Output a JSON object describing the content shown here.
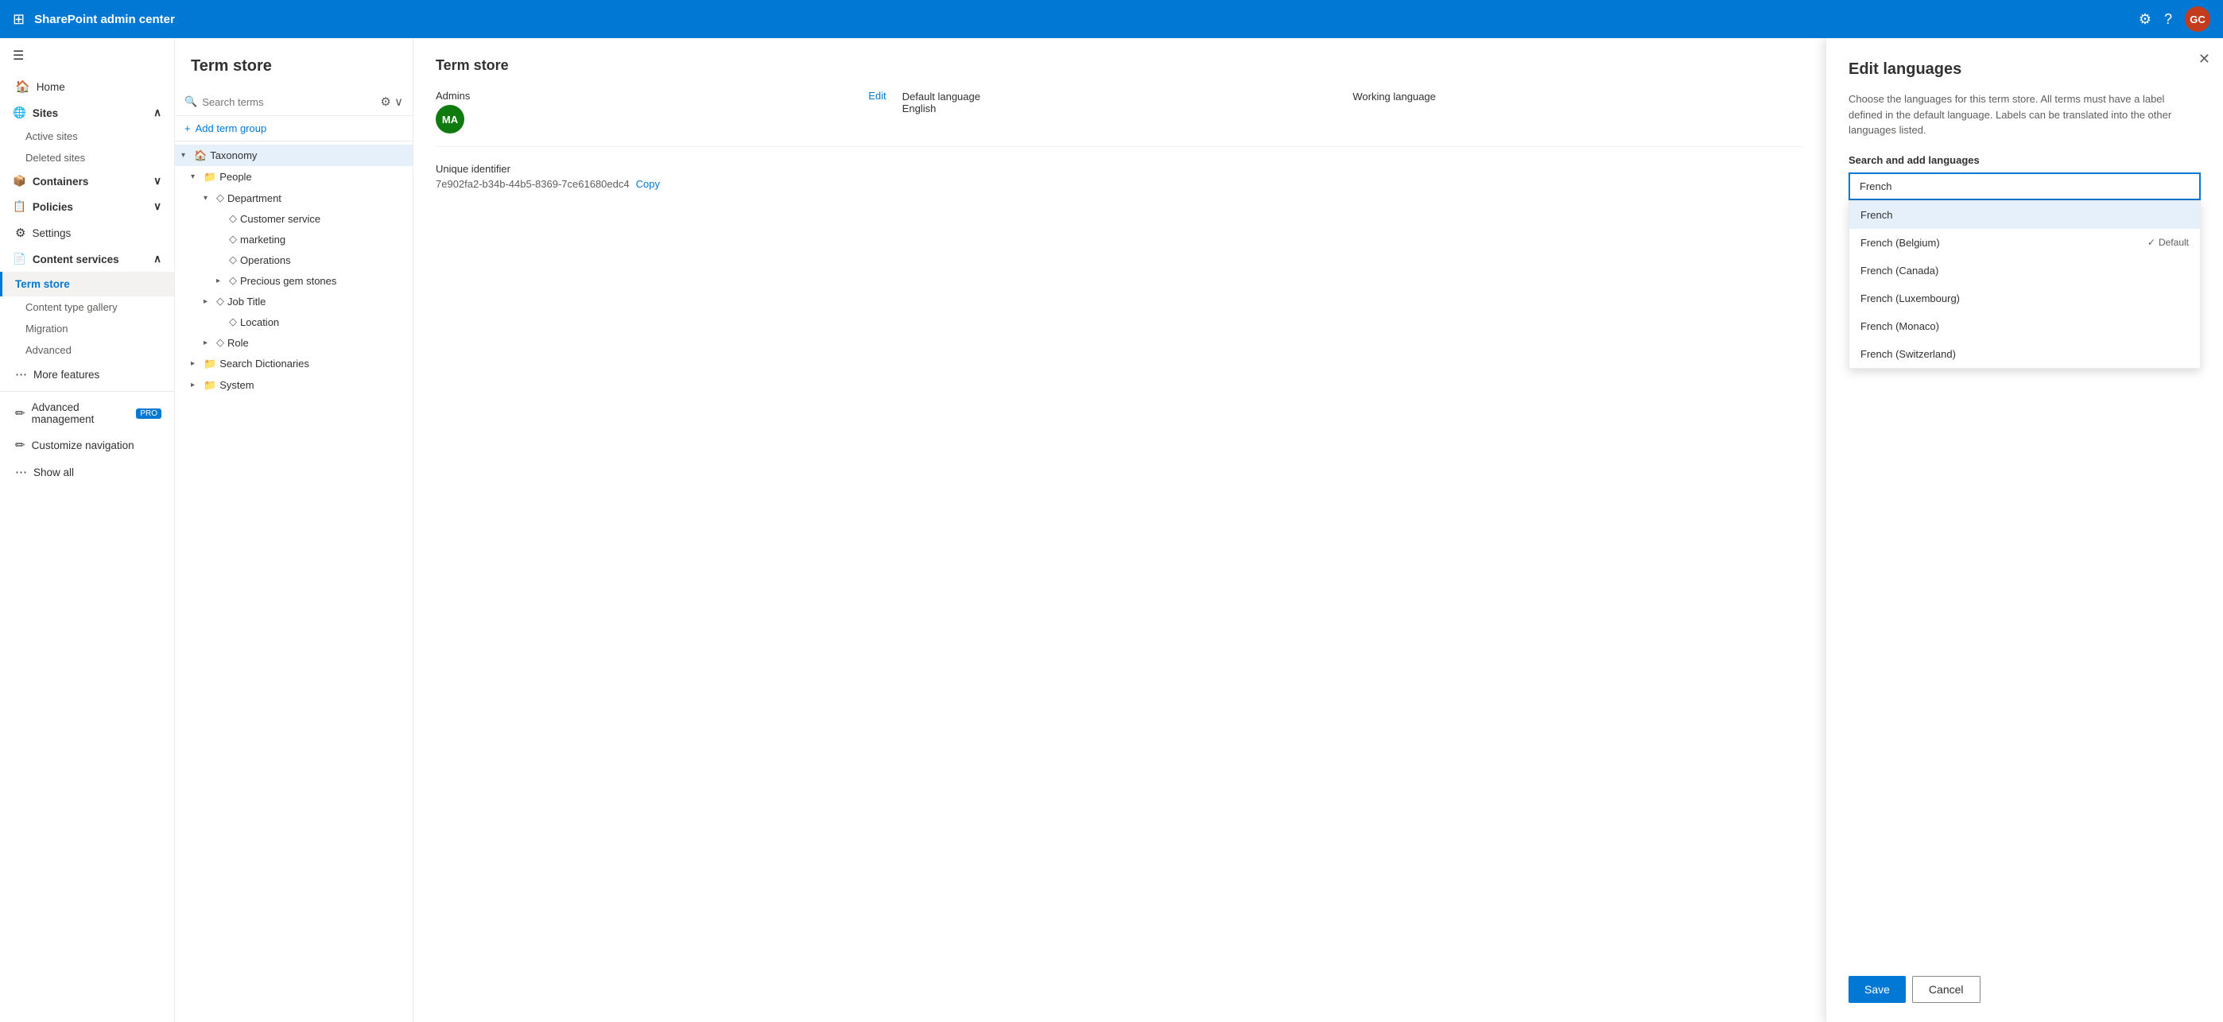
{
  "topbar": {
    "title": "SharePoint admin center",
    "waffle_icon": "⊞",
    "settings_icon": "⚙",
    "help_icon": "?",
    "avatar_initials": "GC"
  },
  "sidebar": {
    "hamburger_icon": "☰",
    "items": [
      {
        "id": "home",
        "label": "Home",
        "icon": "🏠"
      },
      {
        "id": "sites",
        "label": "Sites",
        "icon": "🌐",
        "expanded": true,
        "children": [
          {
            "id": "active-sites",
            "label": "Active sites"
          },
          {
            "id": "deleted-sites",
            "label": "Deleted sites"
          }
        ]
      },
      {
        "id": "containers",
        "label": "Containers",
        "icon": "📦",
        "expanded": false
      },
      {
        "id": "policies",
        "label": "Policies",
        "icon": "📋",
        "expanded": false
      },
      {
        "id": "settings",
        "label": "Settings",
        "icon": "⚙"
      },
      {
        "id": "content-services",
        "label": "Content services",
        "icon": "📄",
        "expanded": true,
        "children": [
          {
            "id": "term-store",
            "label": "Term store",
            "active": true
          },
          {
            "id": "content-type-gallery",
            "label": "Content type gallery"
          },
          {
            "id": "migration",
            "label": "Migration"
          },
          {
            "id": "advanced",
            "label": "Advanced"
          }
        ]
      },
      {
        "id": "more-features",
        "label": "More features",
        "icon": "⋯"
      },
      {
        "id": "advanced-management",
        "label": "Advanced management",
        "icon": "✏",
        "badge": "PRO"
      },
      {
        "id": "customize-navigation",
        "label": "Customize navigation",
        "icon": "✏"
      },
      {
        "id": "show-all",
        "label": "Show all",
        "icon": "⋯"
      }
    ]
  },
  "term_store": {
    "page_title": "Term store",
    "search_placeholder": "Search terms",
    "add_term_group_label": "Add term group",
    "tree": [
      {
        "id": "taxonomy",
        "label": "Taxonomy",
        "level": 0,
        "icon": "🏠",
        "has_children": true,
        "expanded": true,
        "has_more": true
      },
      {
        "id": "people",
        "label": "People",
        "level": 1,
        "icon": "📁",
        "has_children": true,
        "expanded": true,
        "has_more": true
      },
      {
        "id": "department",
        "label": "Department",
        "level": 2,
        "icon": "◇",
        "has_children": true,
        "expanded": true
      },
      {
        "id": "customer-service",
        "label": "Customer service",
        "level": 3,
        "icon": "◇"
      },
      {
        "id": "marketing",
        "label": "marketing",
        "level": 3,
        "icon": "◇"
      },
      {
        "id": "operations",
        "label": "Operations",
        "level": 3,
        "icon": "◇"
      },
      {
        "id": "precious-gem-stones",
        "label": "Precious gem stones",
        "level": 3,
        "icon": "◇✦",
        "has_children": true
      },
      {
        "id": "job-title",
        "label": "Job Title",
        "level": 2,
        "icon": "◇",
        "has_children": true
      },
      {
        "id": "location",
        "label": "Location",
        "level": 3,
        "icon": "◇"
      },
      {
        "id": "role",
        "label": "Role",
        "level": 2,
        "icon": "◇",
        "has_children": true
      },
      {
        "id": "search-dictionaries",
        "label": "Search Dictionaries",
        "level": 1,
        "icon": "📁",
        "has_children": true,
        "has_more": true
      },
      {
        "id": "system",
        "label": "System",
        "level": 1,
        "icon": "📁",
        "has_children": true,
        "has_more_x": true
      }
    ]
  },
  "detail_panel": {
    "title": "Term store",
    "admins_label": "Admins",
    "admins_edit": "Edit",
    "admin_avatar": "MA",
    "default_language_label": "Default language",
    "default_language_value": "English",
    "working_language_label": "Working language",
    "unique_identifier_label": "Unique identifier",
    "unique_identifier_value": "7e902fa2-b34b-44b5-8369-7ce61680edc4",
    "unique_identifier_copy": "Copy"
  },
  "edit_panel": {
    "title": "Edit languages",
    "description": "Choose the languages for this term store. All terms must have a label defined in the default language. Labels can be translated into the other languages listed.",
    "search_label": "Search and add languages",
    "search_value": "French",
    "dropdown_options": [
      {
        "id": "french",
        "label": "French",
        "highlighted": true
      },
      {
        "id": "french-belgium",
        "label": "French (Belgium)"
      },
      {
        "id": "french-canada",
        "label": "French (Canada)"
      },
      {
        "id": "french-luxembourg",
        "label": "French (Luxembourg)"
      },
      {
        "id": "french-monaco",
        "label": "French (Monaco)"
      },
      {
        "id": "french-switzerland",
        "label": "French (Switzerland)"
      }
    ],
    "default_tag": "Default",
    "save_label": "Save",
    "cancel_label": "Cancel",
    "close_icon": "✕"
  }
}
